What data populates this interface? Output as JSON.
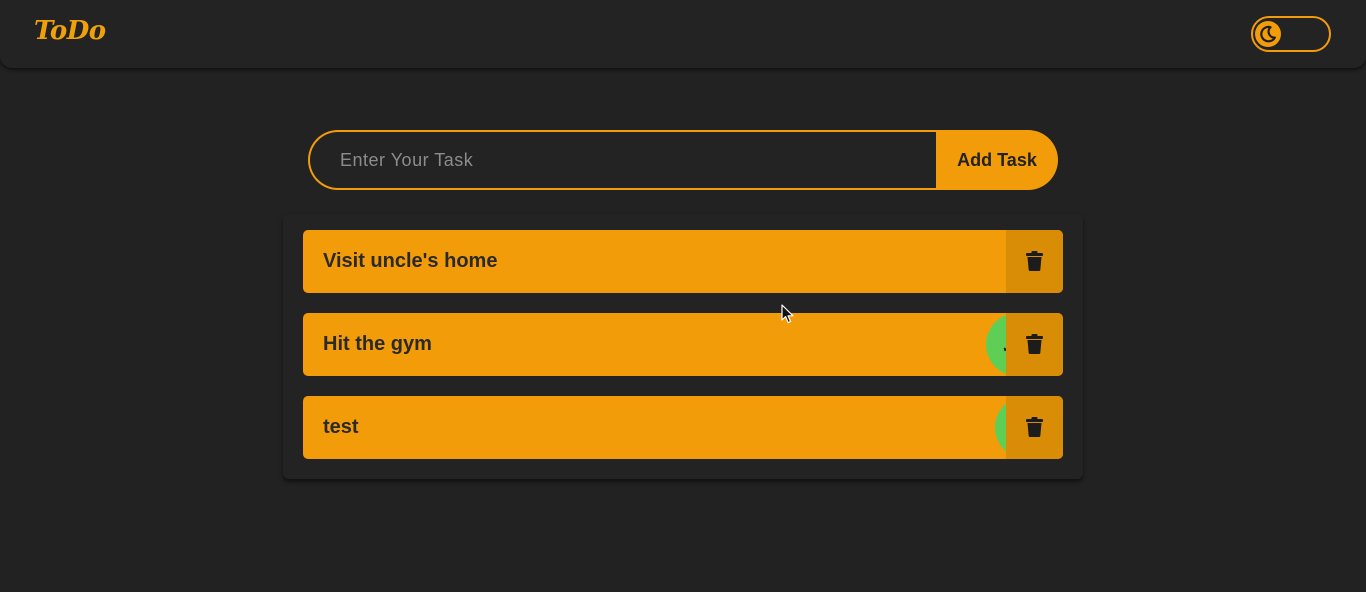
{
  "navbar": {
    "logo": "ToDo",
    "theme_toggle": {
      "state": "dark",
      "icon": "moon-icon"
    }
  },
  "composer": {
    "placeholder": "Enter Your Task",
    "value": "",
    "add_label": "Add Task"
  },
  "tasks": [
    {
      "label": "Visit uncle's home",
      "done_indicator": false
    },
    {
      "label": "Hit the gym",
      "done_indicator": true
    },
    {
      "label": "test",
      "done_indicator": true
    }
  ],
  "colors": {
    "background": "#222222",
    "accent": "#f39c0a",
    "accent_dark": "#d98c06",
    "done": "#5fce55",
    "text_dark": "#2a2a2a"
  }
}
